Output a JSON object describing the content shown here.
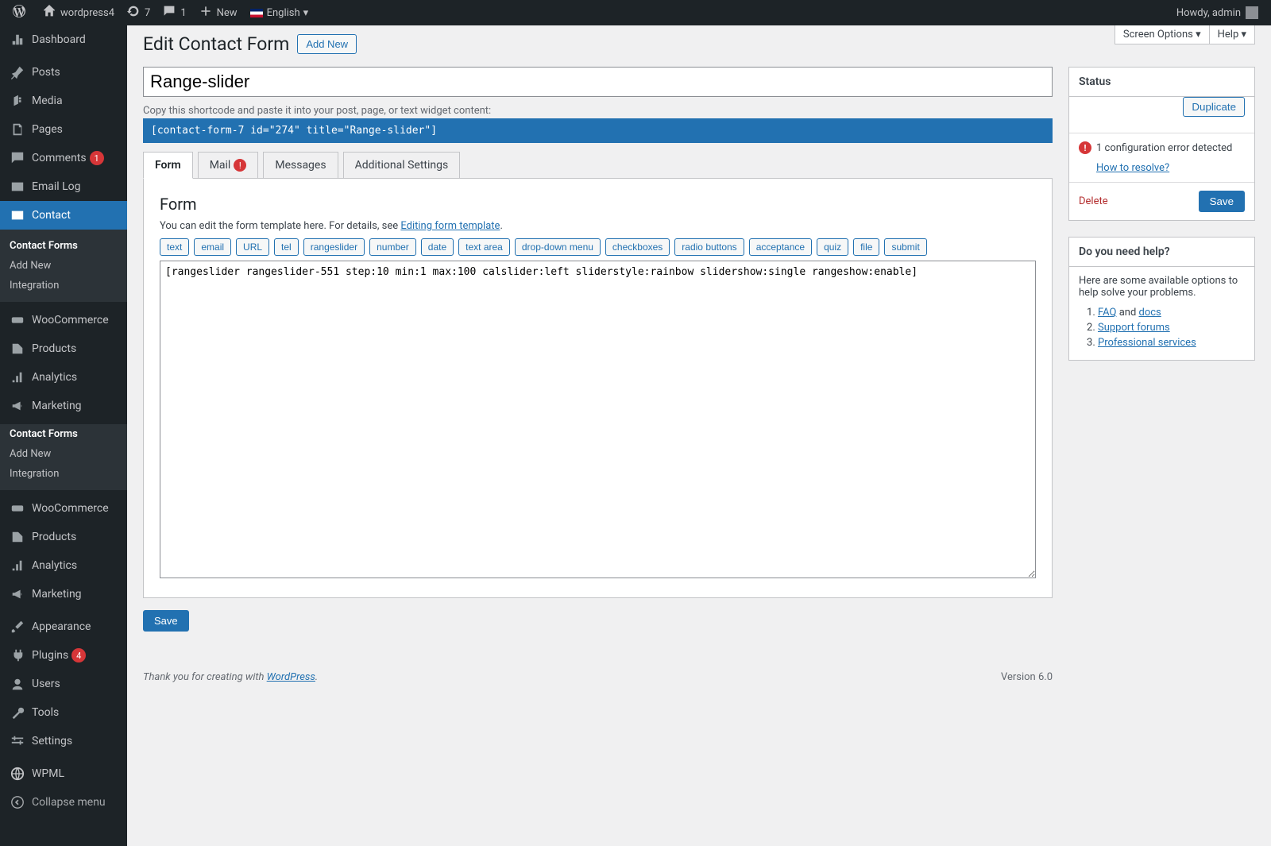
{
  "toolbar": {
    "site_name": "wordpress4",
    "updates_count": "7",
    "comments_count": "1",
    "new_label": "New",
    "language": "English",
    "greeting": "Howdy, admin"
  },
  "sidebar": {
    "dashboard": "Dashboard",
    "posts": "Posts",
    "media": "Media",
    "pages": "Pages",
    "comments": "Comments",
    "comments_badge": "1",
    "email_log": "Email Log",
    "contact": "Contact",
    "contact_sub": {
      "forms": "Contact Forms",
      "add_new": "Add New",
      "integration": "Integration"
    },
    "woocommerce": "WooCommerce",
    "products": "Products",
    "analytics": "Analytics",
    "marketing": "Marketing",
    "contact_forms2": "Contact Forms",
    "add_new2": "Add New",
    "integration2": "Integration",
    "appearance": "Appearance",
    "plugins": "Plugins",
    "plugins_badge": "4",
    "users": "Users",
    "tools": "Tools",
    "settings": "Settings",
    "wpml": "WPML",
    "collapse": "Collapse menu"
  },
  "topright": {
    "screen_options": "Screen Options",
    "help": "Help"
  },
  "heading": {
    "title": "Edit Contact Form",
    "add_new": "Add New"
  },
  "title_input": "Range-slider",
  "shortcode_hint": "Copy this shortcode and paste it into your post, page, or text widget content:",
  "shortcode_value": "[contact-form-7 id=\"274\" title=\"Range-slider\"]",
  "tabs": {
    "form": "Form",
    "mail": "Mail",
    "messages": "Messages",
    "additional": "Additional Settings"
  },
  "panel": {
    "heading": "Form",
    "desc_pre": "You can edit the form template here. For details, see ",
    "desc_link": "Editing form template",
    "tags": [
      "text",
      "email",
      "URL",
      "tel",
      "rangeslider",
      "number",
      "date",
      "text area",
      "drop-down menu",
      "checkboxes",
      "radio buttons",
      "acceptance",
      "quiz",
      "file",
      "submit"
    ],
    "textarea_value": "[rangeslider rangeslider-551 step:10 min:1 max:100 calslider:left sliderstyle:rainbow slidershow:single rangeshow:enable]"
  },
  "save_label": "Save",
  "status_box": {
    "title": "Status",
    "duplicate": "Duplicate",
    "error_text": "1 configuration error detected",
    "resolve": "How to resolve?",
    "delete": "Delete",
    "save": "Save"
  },
  "help_box": {
    "title": "Do you need help?",
    "intro": "Here are some available options to help solve your problems.",
    "faq": "FAQ",
    "and": " and ",
    "docs": "docs",
    "support": "Support forums",
    "pro": "Professional services"
  },
  "footer": {
    "pre": "Thank you for creating with ",
    "link": "WordPress",
    "version": "Version 6.0"
  }
}
